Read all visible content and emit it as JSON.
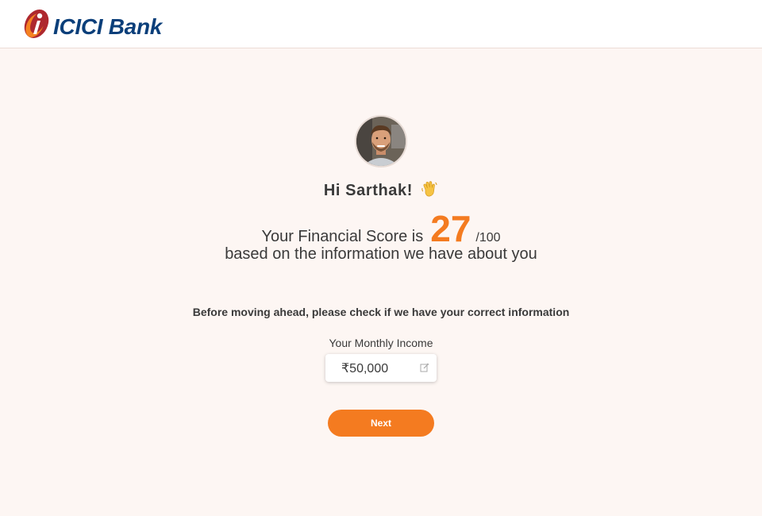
{
  "header": {
    "brand_name": "ICICI Bank",
    "logo_letter": "i"
  },
  "greeting": {
    "text": "Hi Sarthak!",
    "emoji": "👋"
  },
  "score": {
    "label": "Your Financial Score is",
    "value": "27",
    "max": "/100",
    "subtext": "based on the information we have about you"
  },
  "verification": {
    "prompt": "Before moving ahead, please check if we have your correct information",
    "income_label": "Your Monthly Income",
    "income_value": "₹50,000"
  },
  "actions": {
    "next_label": "Next"
  },
  "colors": {
    "accent": "#f47b20",
    "brand_blue": "#0b3f7a",
    "brand_red": "#ae282e",
    "background": "#fdf6f3"
  },
  "icons": {
    "edit": "edit-icon",
    "avatar": "avatar"
  }
}
